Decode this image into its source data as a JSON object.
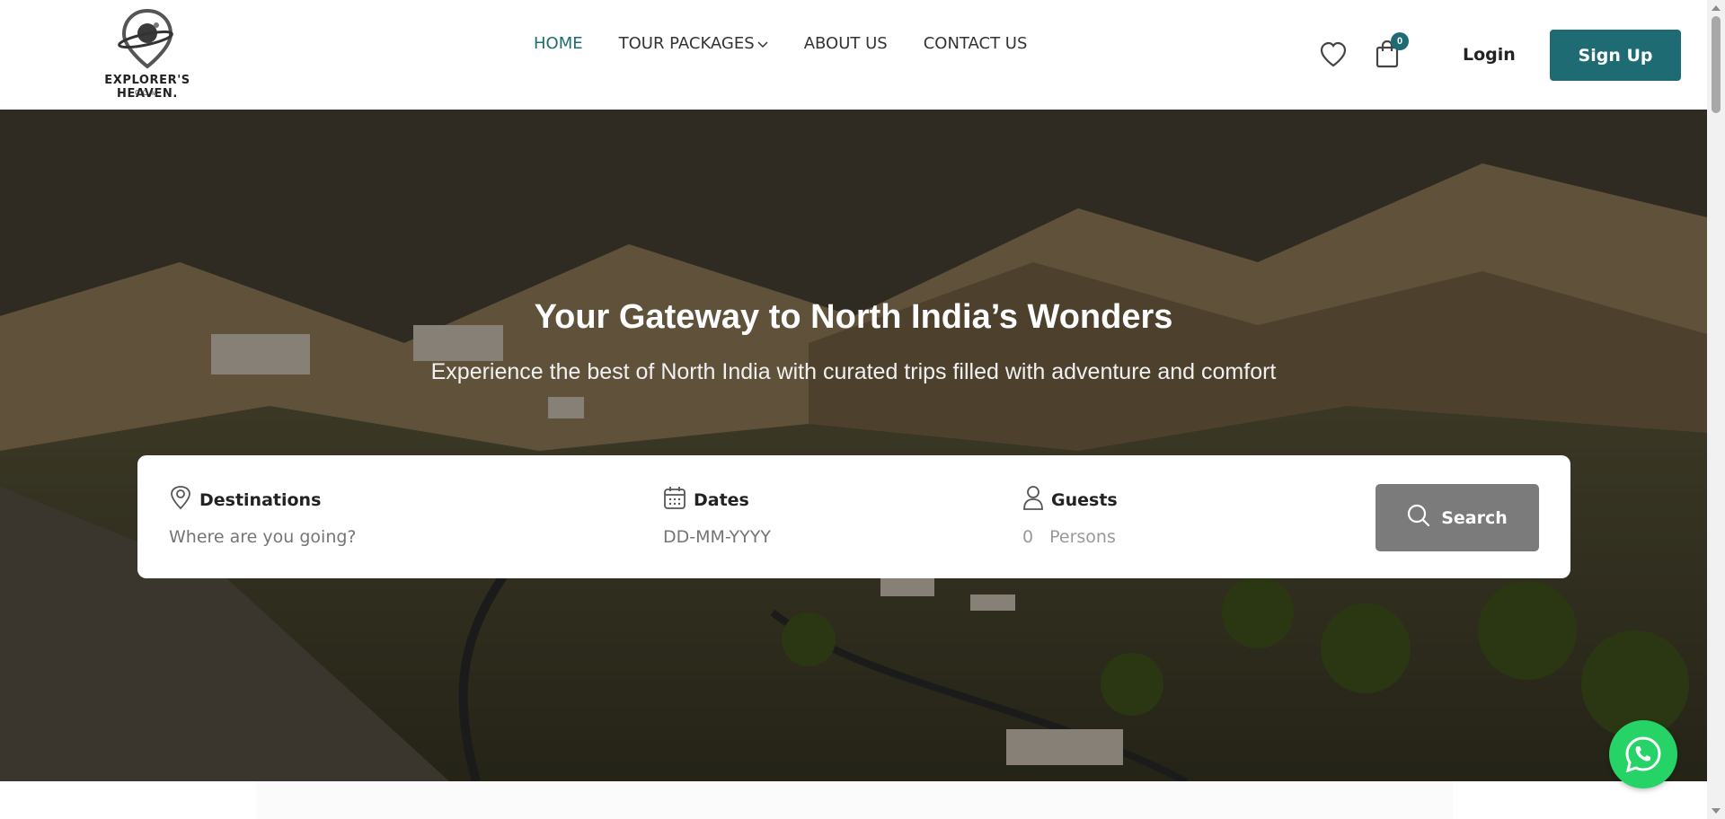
{
  "brand": {
    "name": "EXPLORER'S HEAVEN.",
    "sub": "COM"
  },
  "nav": {
    "items": [
      {
        "label": "HOME",
        "active": true
      },
      {
        "label": "TOUR PACKAGES",
        "has_dropdown": true
      },
      {
        "label": "ABOUT US"
      },
      {
        "label": "CONTACT US"
      }
    ]
  },
  "header": {
    "cart_count": "0",
    "login_label": "Login",
    "signup_label": "Sign Up"
  },
  "hero": {
    "title": "Your Gateway to North India’s Wonders",
    "subtitle": "Experience the best of North India with curated trips filled with adventure and comfort"
  },
  "search": {
    "destinations": {
      "label": "Destinations",
      "placeholder": "Where are you going?",
      "icon": "map-pin-icon"
    },
    "dates": {
      "label": "Dates",
      "placeholder": "DD-MM-YYYY",
      "icon": "calendar-icon"
    },
    "guests": {
      "label": "Guests",
      "count": "0",
      "unit": "Persons",
      "icon": "person-icon"
    },
    "button_label": "Search"
  },
  "colors": {
    "accent": "#1f6b73",
    "search_button": "#7b7b7b",
    "whatsapp": "#25d366"
  }
}
